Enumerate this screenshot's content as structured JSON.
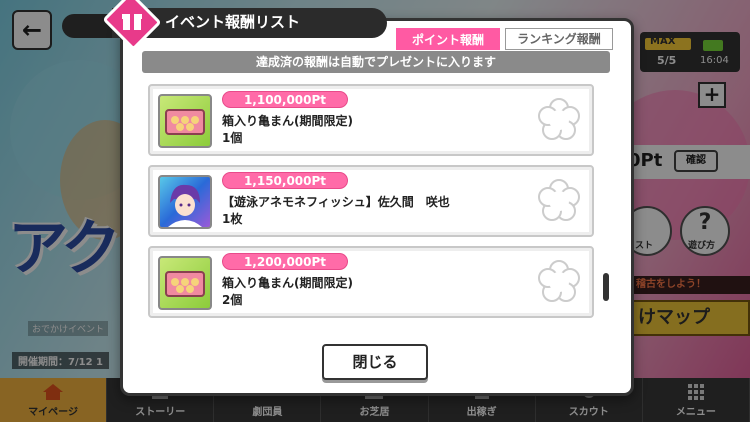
{
  "background": {
    "back_arrow": "←",
    "outing_label": "おでかけイベント",
    "period_label": "開催期間：7/12 1",
    "max_label": "MAX",
    "stamina": "5/5",
    "time": "16:04",
    "plus_label": "+",
    "points_text": "0Pt",
    "confirm_label": "確認",
    "list_label": "リスト",
    "help_label": "遊び方",
    "help_symbol": "?",
    "practice_banner": "稽古をしよう！",
    "map_label": "けマップ"
  },
  "bottom_nav": [
    {
      "label": "マイページ",
      "active": true
    },
    {
      "label": "ストーリー",
      "active": false
    },
    {
      "label": "劇団員",
      "active": false
    },
    {
      "label": "お芝居",
      "active": false
    },
    {
      "label": "出稼ぎ",
      "active": false
    },
    {
      "label": "スカウト",
      "active": false
    },
    {
      "label": "メニュー",
      "active": false
    }
  ],
  "modal": {
    "title": "イベント報酬リスト",
    "tabs": {
      "point": "ポイント報酬",
      "ranking": "ランキング報酬"
    },
    "notice": "達成済の報酬は自動でプレゼントに入ります",
    "rewards": [
      {
        "points": "1,100,000Pt",
        "name": "箱入り亀まん(期間限定)",
        "qty": "1個",
        "thumb": "box"
      },
      {
        "points": "1,150,000Pt",
        "name": "【遊泳アネモネフィッシュ】佐久間　咲也",
        "qty": "1枚",
        "thumb": "chara"
      },
      {
        "points": "1,200,000Pt",
        "name": "箱入り亀まん(期間限定)",
        "qty": "2個",
        "thumb": "box"
      }
    ],
    "close_label": "閉じる"
  },
  "colors": {
    "accent_pink": "#ff6ba8",
    "dark": "#2b2b2b",
    "nav_active": "#f7b640"
  }
}
